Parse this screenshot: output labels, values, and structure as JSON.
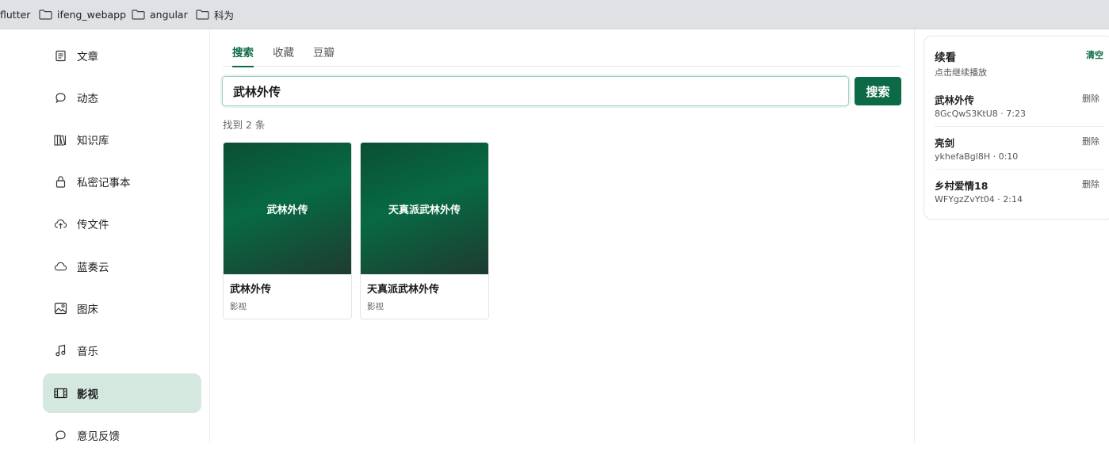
{
  "bookmarks": [
    {
      "label": "flutter"
    },
    {
      "label": "ifeng_webapp"
    },
    {
      "label": "angular"
    },
    {
      "label": "科为"
    }
  ],
  "sidebar": {
    "items": [
      {
        "label": "文章",
        "icon": "article-icon"
      },
      {
        "label": "动态",
        "icon": "chat-bubble-icon"
      },
      {
        "label": "知识库",
        "icon": "books-icon"
      },
      {
        "label": "私密记事本",
        "icon": "lock-icon"
      },
      {
        "label": "传文件",
        "icon": "cloud-upload-icon"
      },
      {
        "label": "蓝奏云",
        "icon": "cloud-icon"
      },
      {
        "label": "图床",
        "icon": "image-icon"
      },
      {
        "label": "音乐",
        "icon": "music-note-icon"
      },
      {
        "label": "影视",
        "icon": "film-icon"
      },
      {
        "label": "意见反馈",
        "icon": "feedback-icon"
      }
    ],
    "active": "影视"
  },
  "main": {
    "tabs": [
      {
        "label": "搜索",
        "active": true
      },
      {
        "label": "收藏",
        "active": false
      },
      {
        "label": "豆瓣",
        "active": false
      }
    ],
    "search": {
      "value": "武林外传",
      "button_label": "搜索"
    },
    "result_count": "找到 2 条",
    "results": [
      {
        "poster_text": "武林外传",
        "title": "武林外传",
        "category": "影视"
      },
      {
        "poster_text": "天真派武林外传",
        "title": "天真派武林外传",
        "category": "影视"
      }
    ]
  },
  "continue": {
    "title": "续看",
    "clear_label": "清空",
    "subtitle": "点击继续播放",
    "items": [
      {
        "title": "武林外传",
        "meta": "8GcQwS3KtU8 · 7:23",
        "delete_label": "删除"
      },
      {
        "title": "亮剑",
        "meta": "ykhefaBgl8H · 0:10",
        "delete_label": "删除"
      },
      {
        "title": "乡村爱情18",
        "meta": "WFYgzZvYt04 · 2:14",
        "delete_label": "删除"
      }
    ]
  },
  "colors": {
    "accent": "#0c6b46",
    "active_nav_bg": "#d5e8e0",
    "poster_dark": "#0b4f35"
  }
}
